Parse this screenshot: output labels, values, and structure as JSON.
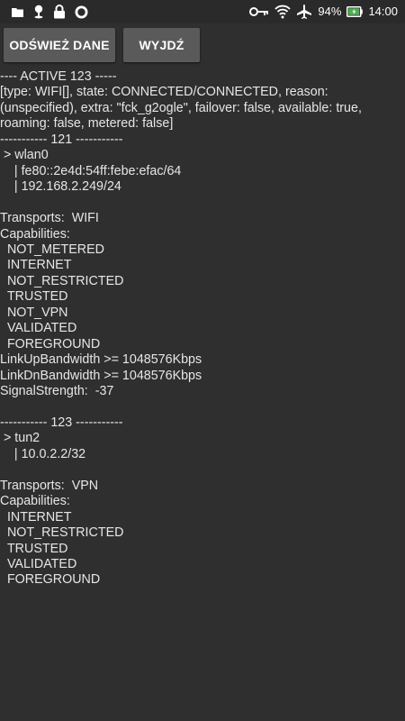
{
  "status_bar": {
    "left_icons": [
      "folder-icon",
      "location-pin-icon",
      "lock-icon",
      "record-icon"
    ],
    "right_icons": [
      "vpn-key-icon",
      "wifi-icon",
      "airplane-mode-icon",
      "battery-charging-icon"
    ],
    "battery": "94%",
    "time": "14:00",
    "battery_color": "#4caf50"
  },
  "buttons": {
    "refresh_label": "ODŚWIEŻ DANE",
    "exit_label": "WYJDŹ"
  },
  "log": {
    "lines": [
      "---- ACTIVE 123 -----",
      "[type: WIFI[], state: CONNECTED/CONNECTED, reason:",
      "(unspecified), extra: \"fck_g2ogle\", failover: false, available: true,",
      "roaming: false, metered: false]",
      "----------- 121 -----------",
      " > wlan0",
      "    | fe80::2e4d:54ff:febe:efac/64",
      "    | 192.168.2.249/24",
      "",
      "Transports:  WIFI",
      "Capabilities:",
      "  NOT_METERED",
      "  INTERNET",
      "  NOT_RESTRICTED",
      "  TRUSTED",
      "  NOT_VPN",
      "  VALIDATED",
      "  FOREGROUND",
      "LinkUpBandwidth >= 1048576Kbps",
      "LinkDnBandwidth >= 1048576Kbps",
      "SignalStrength:  -37",
      "",
      "----------- 123 -----------",
      " > tun2",
      "    | 10.0.2.2/32",
      "",
      "Transports:  VPN",
      "Capabilities:",
      "  INTERNET",
      "  NOT_RESTRICTED",
      "  TRUSTED",
      "  VALIDATED",
      "  FOREGROUND"
    ]
  }
}
